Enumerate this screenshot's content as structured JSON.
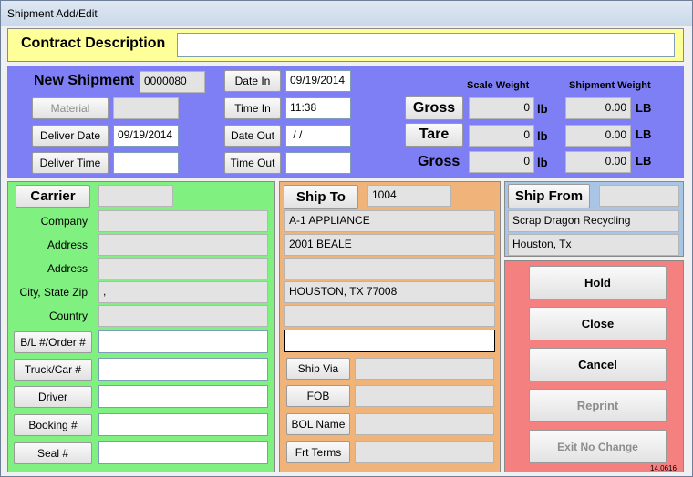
{
  "window": {
    "title": "Shipment Add/Edit"
  },
  "contract": {
    "label": "Contract Description",
    "value": ""
  },
  "shipment": {
    "new_label": "New Shipment",
    "number": "0000080",
    "material_btn": "Material",
    "material_value": "",
    "deliver_date_btn": "Deliver Date",
    "deliver_date": "09/19/2014",
    "deliver_time_btn": "Deliver Time",
    "deliver_time": "",
    "date_in_btn": "Date In",
    "date_in": "09/19/2014",
    "time_in_btn": "Time In",
    "time_in": "11:38",
    "date_out_btn": "Date Out",
    "date_out": " / /",
    "time_out_btn": "Time Out",
    "time_out": ""
  },
  "weights": {
    "scale_header": "Scale Weight",
    "shipment_header": "Shipment Weight",
    "gross_btn": "Gross",
    "tare_btn": "Tare",
    "gross_label": "Gross",
    "scale_gross": "0",
    "scale_tare": "0",
    "scale_net": "0",
    "ship_gross": "0.00",
    "ship_tare": "0.00",
    "ship_net": "0.00",
    "unit_lb": "lb",
    "unit_LB": "LB"
  },
  "carrier": {
    "btn": "Carrier",
    "code": "",
    "company_label": "Company",
    "company": "",
    "address1_label": "Address",
    "address1": "",
    "address2_label": "Address",
    "address2": "",
    "csz_label": "City, State Zip",
    "csz": ",",
    "country_label": "Country",
    "country": "",
    "bl_btn": "B/L #/Order #",
    "bl": "",
    "truck_btn": "Truck/Car #",
    "truck": "",
    "driver_btn": "Driver",
    "driver": "",
    "booking_btn": "Booking #",
    "booking": "",
    "seal_btn": "Seal #",
    "seal": ""
  },
  "shipto": {
    "btn": "Ship To",
    "code": "1004",
    "line1": "A-1 APPLIANCE",
    "line2": "2001 BEALE",
    "line3": "",
    "line4": "HOUSTON, TX 77008",
    "line5": "",
    "line6": "",
    "shipvia_btn": "Ship Via",
    "shipvia": "",
    "fob_btn": "FOB",
    "fob": "",
    "bolname_btn": "BOL Name",
    "bolname": "",
    "frtterms_btn": "Frt Terms",
    "frtterms": ""
  },
  "shipfrom": {
    "btn": "Ship From",
    "code": "",
    "line1": "Scrap Dragon Recycling",
    "line2": "Houston, Tx"
  },
  "actions": {
    "hold": "Hold",
    "close": "Close",
    "cancel": "Cancel",
    "reprint": "Reprint",
    "exit": "Exit No Change",
    "version": "14.0616"
  },
  "colors": {
    "yellow": "#ffff99",
    "blue": "#7f7ff5",
    "green": "#80f080",
    "orange": "#f0b47a",
    "lightblue": "#a9c5e6",
    "red": "#f58080"
  }
}
